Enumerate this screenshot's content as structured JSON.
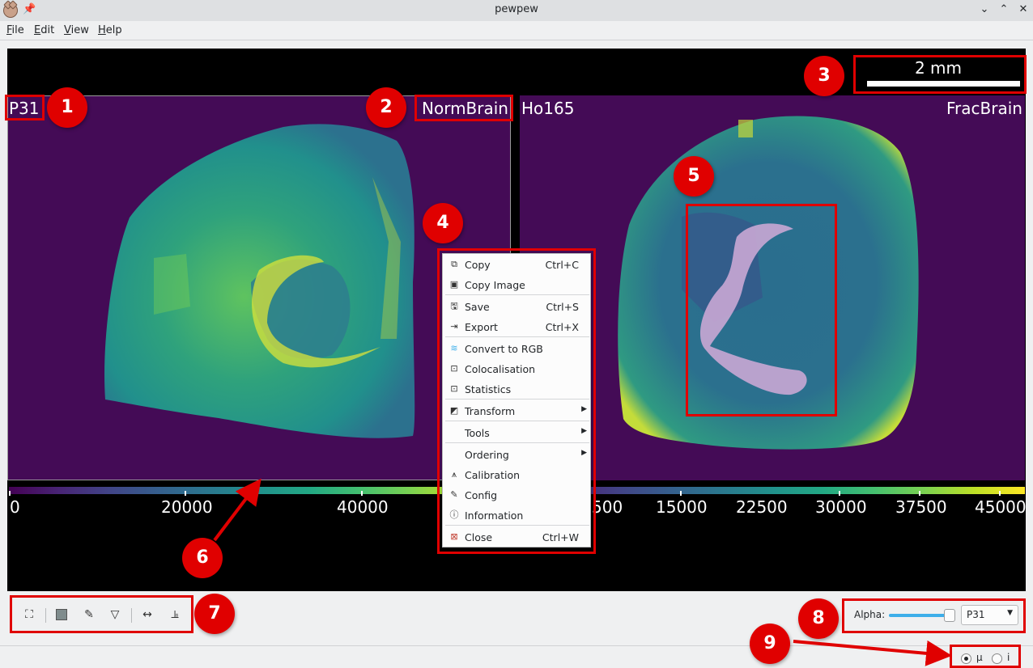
{
  "window": {
    "title": "pewpew"
  },
  "menu": [
    {
      "label": "File",
      "accel": "F",
      "rest": "ile"
    },
    {
      "label": "Edit",
      "accel": "E",
      "rest": "dit"
    },
    {
      "label": "View",
      "accel": "V",
      "rest": "iew"
    },
    {
      "label": "Help",
      "accel": "H",
      "rest": "elp"
    }
  ],
  "scalebar": {
    "label": "2 mm"
  },
  "left_image": {
    "label": "P31",
    "name": "NormBrain",
    "colorbar_ticks": [
      "0",
      "20000",
      "40000"
    ]
  },
  "right_image": {
    "label": "Ho165",
    "name": "FracBrain",
    "colorbar_ticks": [
      "500",
      "15000",
      "22500",
      "30000",
      "37500",
      "45000"
    ]
  },
  "context_menu": {
    "items": [
      {
        "label": "Copy",
        "shortcut": "Ctrl+C",
        "icon": "copy-icon"
      },
      {
        "label": "Copy Image",
        "shortcut": "",
        "icon": "copy-image-icon"
      },
      {
        "label": "Save",
        "shortcut": "Ctrl+S",
        "icon": "save-icon"
      },
      {
        "label": "Export",
        "shortcut": "Ctrl+X",
        "icon": "export-icon"
      },
      {
        "label": "Convert to RGB",
        "shortcut": "",
        "icon": "convert-rgb-icon"
      },
      {
        "label": "Colocalisation",
        "shortcut": "",
        "icon": "colocalisation-icon"
      },
      {
        "label": "Statistics",
        "shortcut": "",
        "icon": "statistics-icon"
      },
      {
        "label": "Transform",
        "shortcut": "",
        "icon": "transform-icon"
      },
      {
        "label": "Tools",
        "shortcut": "",
        "icon": ""
      },
      {
        "label": "Ordering",
        "shortcut": "",
        "icon": ""
      },
      {
        "label": "Calibration",
        "shortcut": "",
        "icon": "calibration-icon"
      },
      {
        "label": "Config",
        "shortcut": "",
        "icon": "config-icon"
      },
      {
        "label": "Information",
        "shortcut": "",
        "icon": "information-icon"
      },
      {
        "label": "Close",
        "shortcut": "Ctrl+W",
        "icon": "close-icon"
      }
    ]
  },
  "toolbar": {
    "icons": [
      "select-region-icon",
      "fill-icon",
      "draw-icon",
      "filter-icon",
      "ruler-icon",
      "histogram-icon"
    ]
  },
  "alpha": {
    "label": "Alpha:",
    "value": 1.0,
    "selected": "P31"
  },
  "status": {
    "radio_mu": "µ",
    "radio_i": "i",
    "selected": "µ"
  },
  "annotations": [
    "1",
    "2",
    "3",
    "4",
    "5",
    "6",
    "7",
    "8",
    "9"
  ],
  "colors": {
    "annotation": "#e00000",
    "image_bg": "#440b56",
    "accent": "#3daee9"
  }
}
